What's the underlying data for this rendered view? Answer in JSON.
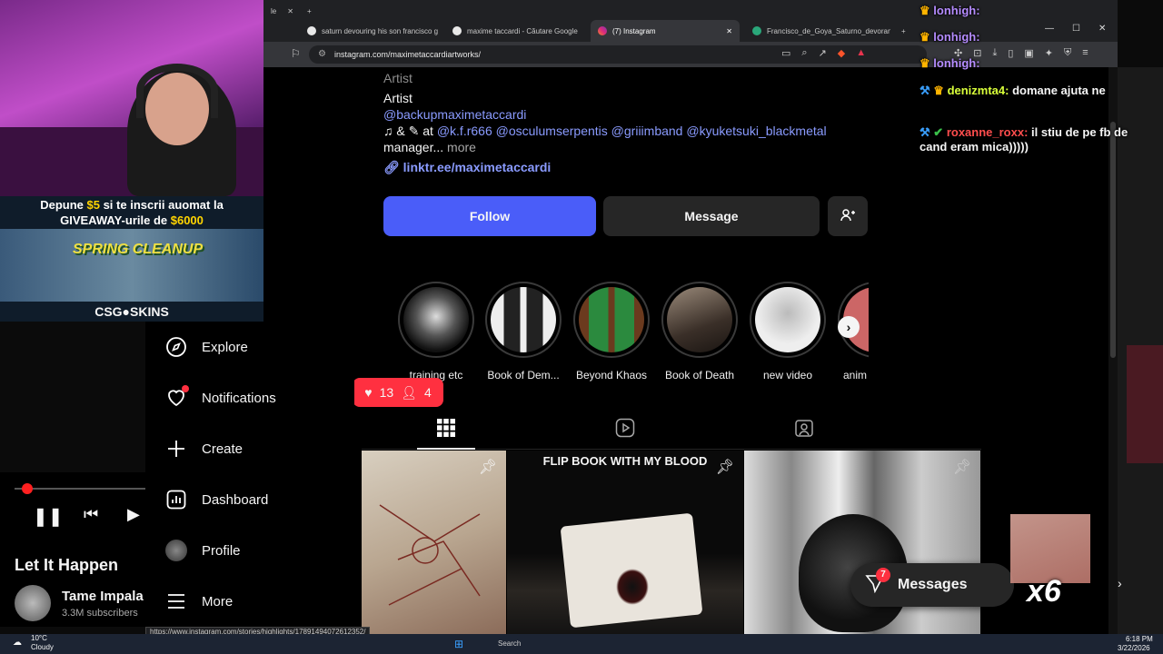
{
  "browser": {
    "tabs": [
      {
        "label": "le"
      },
      {
        "label": "saturn devouring his son francisco g"
      },
      {
        "label": "maxime taccardi - Căutare Google"
      },
      {
        "label": "(7) Instagram"
      },
      {
        "label": "Francisco_de_Goya_Saturno_devoran"
      }
    ],
    "url": "instagram.com/maximetaccardiartworks/",
    "status_url": "https://www.instagram.com/stories/highlights/17891494072612352/"
  },
  "profile": {
    "category_faded": "Artist",
    "category": "Artist",
    "backup_handle": "@backupmaximetaccardi",
    "bio_at": "& ",
    "bio_at2": " at ",
    "bio_links": [
      "@k.f.r666",
      "@osculumserpentis",
      "@griiimband",
      "@kyuketsuki_blackmetal"
    ],
    "bio_manager": "manager...",
    "bio_more": "more",
    "external_link": "linktr.ee/maximetaccardi",
    "follow_label": "Follow",
    "message_label": "Message"
  },
  "highlights": [
    {
      "label": "training etc"
    },
    {
      "label": "Book of Dem..."
    },
    {
      "label": "Beyond Khaos"
    },
    {
      "label": "Book of Death"
    },
    {
      "label": "new video"
    },
    {
      "label": "anim"
    }
  ],
  "notif_bubble": {
    "likes": "13",
    "follows": "4"
  },
  "posts": [
    {
      "caption": ""
    },
    {
      "caption": "FLIP BOOK WITH MY BLOOD"
    },
    {
      "caption": ""
    }
  ],
  "sidenav": {
    "items": [
      {
        "label": "Explore",
        "icon": "compass-icon"
      },
      {
        "label": "Notifications",
        "icon": "heart-icon"
      },
      {
        "label": "Create",
        "icon": "plus-icon"
      },
      {
        "label": "Dashboard",
        "icon": "chart-icon"
      },
      {
        "label": "Profile",
        "icon": "avatar-icon"
      },
      {
        "label": "More",
        "icon": "menu-icon"
      }
    ]
  },
  "messages": {
    "label": "Messages",
    "badge": "7",
    "multiplier": "x6"
  },
  "stream": {
    "promo_line1_pre": "Depune ",
    "promo_amount1": "$5",
    "promo_line1_post": " si te inscrii auomat la",
    "promo_line2_pre": "GIVEAWAY-urile de ",
    "promo_amount2": "$6000",
    "promo_banner": "SPRING CLEANUP",
    "promo_brand": "CSG●SKINS",
    "chat": [
      {
        "user": "lonhigh:",
        "text": "",
        "color": "#b58cff"
      },
      {
        "user": "lonhigh:",
        "text": "",
        "color": "#b58cff"
      },
      {
        "user": "lonhigh:",
        "text": "",
        "color": "#b58cff"
      },
      {
        "user": "denizmta4:",
        "text": "domane ajuta ne",
        "color": "#d9ff3a"
      },
      {
        "user": "roxanne_roxx:",
        "text": "il stiu de pe fb de cand eram mica)))))",
        "color": "#ff4d4d"
      }
    ]
  },
  "player": {
    "song": "Let It Happen",
    "artist": "Tame Impala",
    "subscribers": "3.3M subscribers"
  },
  "taskbar": {
    "weather_temp": "10°C",
    "weather_desc": "Cloudy",
    "search": "Search",
    "time": "6:18 PM",
    "date": "3/22/2026"
  },
  "colors": {
    "accent": "#4a5df9",
    "link": "#8a9bff",
    "notif": "#ff3040"
  }
}
